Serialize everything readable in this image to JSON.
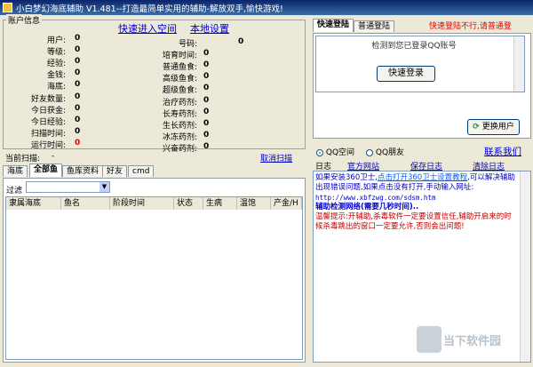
{
  "window": {
    "title": "小白梦幻海底辅助 V1.481--打造最简单实用的辅助-解放双手,愉快游戏!"
  },
  "account": {
    "group_title": "账户信息",
    "links": {
      "quick_enter": "快速进入空间",
      "local_settings": "本地设置"
    },
    "left_fields": [
      {
        "label": "用户:",
        "value": "0"
      },
      {
        "label": "等级:",
        "value": "0"
      },
      {
        "label": "经验:",
        "value": "0"
      },
      {
        "label": "金钱:",
        "value": "0"
      },
      {
        "label": "海底:",
        "value": "0"
      },
      {
        "label": "好友数量:",
        "value": "0"
      },
      {
        "label": "今日获金:",
        "value": "0"
      },
      {
        "label": "今日经验:",
        "value": "0"
      },
      {
        "label": "扫描时间:",
        "value": "0"
      },
      {
        "label": "运行时间:",
        "value": "0"
      }
    ],
    "right_fields": [
      {
        "label": "号码:",
        "value": "0"
      },
      {
        "label": "培育时间:",
        "value": "0"
      },
      {
        "label": "普通鱼食:",
        "value": "0"
      },
      {
        "label": "高级鱼食:",
        "value": "0"
      },
      {
        "label": "超级鱼食:",
        "value": "0"
      },
      {
        "label": "治疗药剂:",
        "value": "0"
      },
      {
        "label": "长寿药剂:",
        "value": "0"
      },
      {
        "label": "生长药剂:",
        "value": "0"
      },
      {
        "label": "冰冻药剂:",
        "value": "0"
      },
      {
        "label": "兴奋药剂:",
        "value": "0"
      }
    ]
  },
  "scan": {
    "label": "当前扫描:",
    "value": "-",
    "cancel_link": "取消扫描"
  },
  "bottom_tabs": [
    "海底",
    "全部鱼",
    "鱼库资料",
    "好友",
    "cmd"
  ],
  "filter": {
    "label": "过滤",
    "selected": ""
  },
  "fish_table": {
    "columns": [
      "隶属海底",
      "鱼名",
      "阶段时间",
      "状态",
      "生病",
      "温饱",
      "产金/H"
    ]
  },
  "login": {
    "tabs": [
      "快速登陆",
      "普通登陆"
    ],
    "warning": "快速登陆不行,请普通登",
    "detected_text": "检测到您已登录QQ账号",
    "login_button": "快速登录",
    "switch_user_button": "更换用户"
  },
  "mode": {
    "options": [
      "QQ空间",
      "QQ朋友"
    ],
    "selected_index": 0,
    "contact_link": "联系我们"
  },
  "log_bar": {
    "label": "日志",
    "links": [
      "官方网站",
      "保存日志",
      "清除日志"
    ]
  },
  "log": {
    "line1_prefix": "如果安装360卫士,",
    "line1_link": "点击打开360卫士设置教程",
    "line1_rest": ",可以解决辅助出现错误问题,如果点击没有打开,手动输入网址:",
    "url_line": "http://www.xbfzwg.com/sdsm.htm",
    "detect_line": "辅助检测网络(需要几秒时间)..",
    "tip": "温馨提示:开辅助,杀毒软件一定要设置信任,辅助开启来的时候杀毒跳出的窗口一定要允许,否则会出问题!"
  },
  "watermark": "当下软件园",
  "colors": {
    "link": "#0000cc",
    "warning": "#e00000",
    "log_blue": "#0000c8",
    "log_red": "#c00000"
  }
}
